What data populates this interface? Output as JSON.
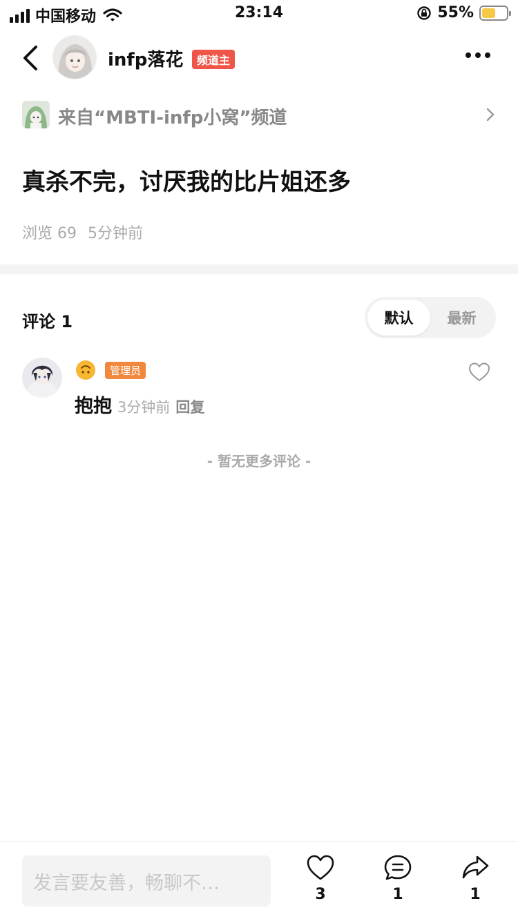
{
  "status_bar": {
    "carrier": "中国移动",
    "time": "23:14",
    "battery_percent": "55%",
    "battery_color": "#f7c948"
  },
  "header": {
    "username": "infp落花",
    "owner_badge": "频道主",
    "owner_badge_color": "#ef5548"
  },
  "channel": {
    "label": "来自“MBTI-infp小窝”频道"
  },
  "post": {
    "title": "真杀不完，讨厌我的比片姐还多",
    "views": "浏览 69",
    "time_ago": "5分钟前"
  },
  "comments_section": {
    "title": "评论 1",
    "sort_options": [
      "默认",
      "最新"
    ],
    "active_sort": "默认"
  },
  "comments": [
    {
      "emoji": "🙃",
      "badge": "管理员",
      "badge_color": "#f0883e",
      "text": "抱抱",
      "time": "3分钟前",
      "reply_label": "回复"
    }
  ],
  "footer_note": "- 暂无更多评论 -",
  "bottom_bar": {
    "input_placeholder": "发言要友善，畅聊不…",
    "like_count": "3",
    "comment_count": "1",
    "share_count": "1"
  }
}
